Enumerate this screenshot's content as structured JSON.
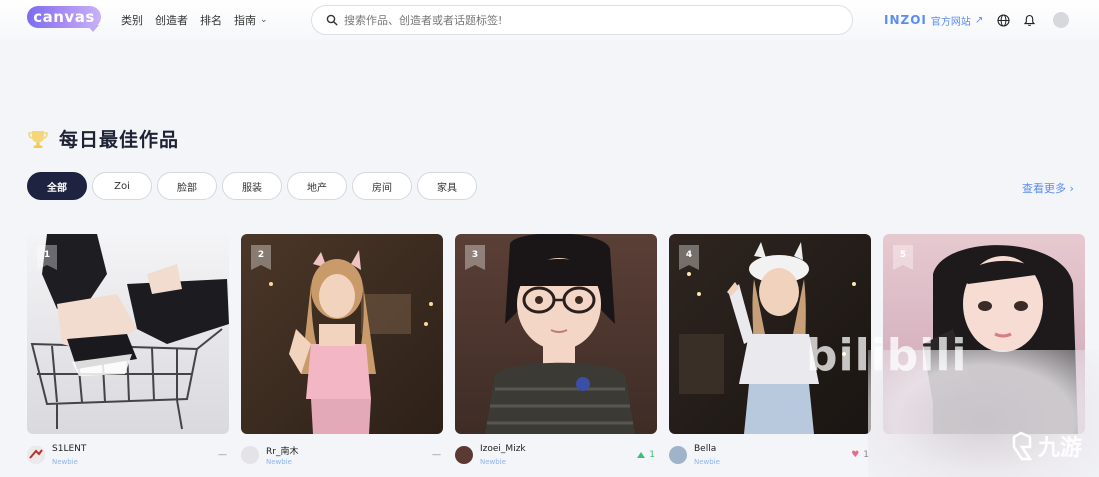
{
  "header": {
    "logo_text": "canvas",
    "nav": [
      "类别",
      "创造者",
      "排名",
      "指南"
    ],
    "search_placeholder": "搜索作品、创造者或者话题标签!",
    "inzoi_brand": "INZOI",
    "official_site": "官方网站"
  },
  "section": {
    "title": "每日最佳作品",
    "tabs": [
      "全部",
      "Zoi",
      "脸部",
      "服装",
      "地产",
      "房间",
      "家具"
    ],
    "see_more": "查看更多 ›"
  },
  "cards": [
    {
      "rank": "1",
      "name": "S1LENT",
      "level": "Newbie",
      "likes": "—"
    },
    {
      "rank": "2",
      "name": "Rr_南木",
      "level": "Newbie",
      "likes": "—"
    },
    {
      "rank": "3",
      "name": "Izoei_Mizk",
      "level": "Newbie",
      "likes": "1"
    },
    {
      "rank": "4",
      "name": "Bella",
      "level": "Newbie",
      "likes": "1"
    },
    {
      "rank": "5",
      "name": "",
      "level": "",
      "likes": ""
    }
  ],
  "watermark": {
    "bili": "bilibili",
    "site": "九游"
  },
  "colors": {
    "accent": "#5b8def",
    "active_tab": "#1d2340",
    "trophy": "#f2c94c"
  }
}
